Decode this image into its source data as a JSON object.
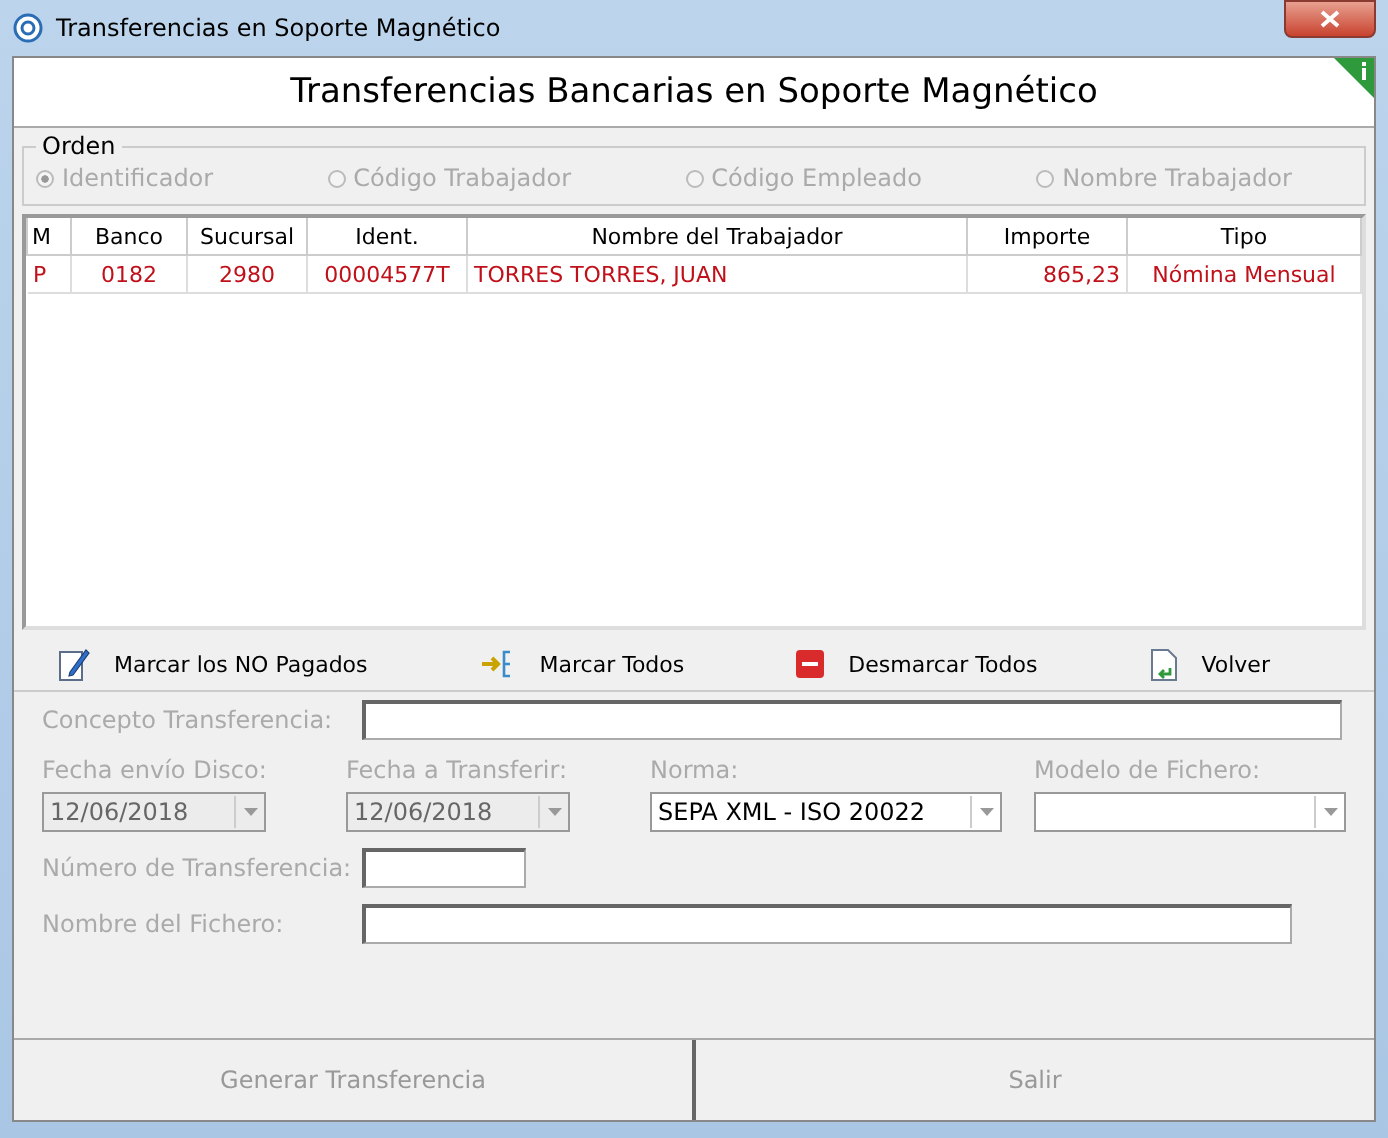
{
  "window": {
    "title": "Transferencias en Soporte Magnético"
  },
  "header": {
    "title": "Transferencias Bancarias en Soporte Magnético"
  },
  "orden": {
    "label": "Orden",
    "options": [
      {
        "label": "Identificador",
        "selected": true
      },
      {
        "label": "Código Trabajador",
        "selected": false
      },
      {
        "label": "Código Empleado",
        "selected": false
      },
      {
        "label": "Nombre Trabajador",
        "selected": false
      }
    ]
  },
  "table": {
    "columns": [
      "M",
      "Banco",
      "Sucursal",
      "Ident.",
      "Nombre del Trabajador",
      "Importe",
      "Tipo"
    ],
    "rows": [
      {
        "cells": [
          "P",
          "0182",
          "2980",
          "00004577T",
          "TORRES TORRES, JUAN",
          "865,23",
          "Nómina Mensual"
        ]
      }
    ]
  },
  "toolbar": [
    {
      "label": "Marcar los NO Pagados",
      "kind": "edit"
    },
    {
      "label": "Marcar Todos",
      "kind": "mark"
    },
    {
      "label": "Desmarcar Todos",
      "kind": "unmark"
    },
    {
      "label": "Volver",
      "kind": "back"
    }
  ],
  "form": {
    "concepto": {
      "label": "Concepto Transferencia:"
    },
    "selects": [
      {
        "label": "Fecha envío Disco:",
        "value": "12/06/2018",
        "disabled": true
      },
      {
        "label": "Fecha a Transferir:",
        "value": "12/06/2018",
        "disabled": true
      },
      {
        "label": "Norma:",
        "value": "SEPA XML - ISO 20022",
        "disabled": false
      },
      {
        "label": "Modelo de Fichero:",
        "disabled": false
      }
    ],
    "numero": {
      "label": "Número de Transferencia:"
    },
    "fichero": {
      "label": "Nombre del Fichero:"
    }
  },
  "buttons": [
    {
      "label": "Generar Transferencia",
      "disabled": true
    },
    {
      "label": "Salir",
      "disabled": true
    }
  ]
}
